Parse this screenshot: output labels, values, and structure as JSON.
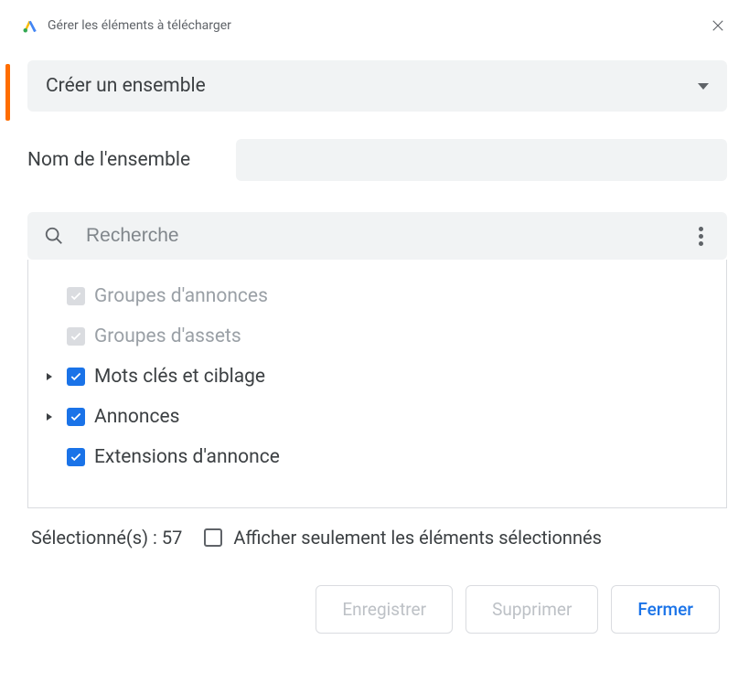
{
  "header": {
    "title": "Gérer les éléments à télécharger"
  },
  "dropdown": {
    "label": "Créer un ensemble"
  },
  "nameField": {
    "label": "Nom de l'ensemble",
    "value": ""
  },
  "search": {
    "placeholder": "Recherche"
  },
  "tree": {
    "items": [
      {
        "label": "Groupes d'annonces",
        "checked": true,
        "disabled": true,
        "expandable": false
      },
      {
        "label": "Groupes d'assets",
        "checked": true,
        "disabled": true,
        "expandable": false
      },
      {
        "label": "Mots clés et ciblage",
        "checked": true,
        "disabled": false,
        "expandable": true
      },
      {
        "label": "Annonces",
        "checked": true,
        "disabled": false,
        "expandable": true
      },
      {
        "label": "Extensions d'annonce",
        "checked": true,
        "disabled": false,
        "expandable": false
      }
    ]
  },
  "footer": {
    "selectedText": "Sélectionné(s) : 57",
    "showOnlySelectedLabel": "Afficher seulement les éléments sélectionnés"
  },
  "buttons": {
    "save": "Enregistrer",
    "delete": "Supprimer",
    "close": "Fermer"
  }
}
